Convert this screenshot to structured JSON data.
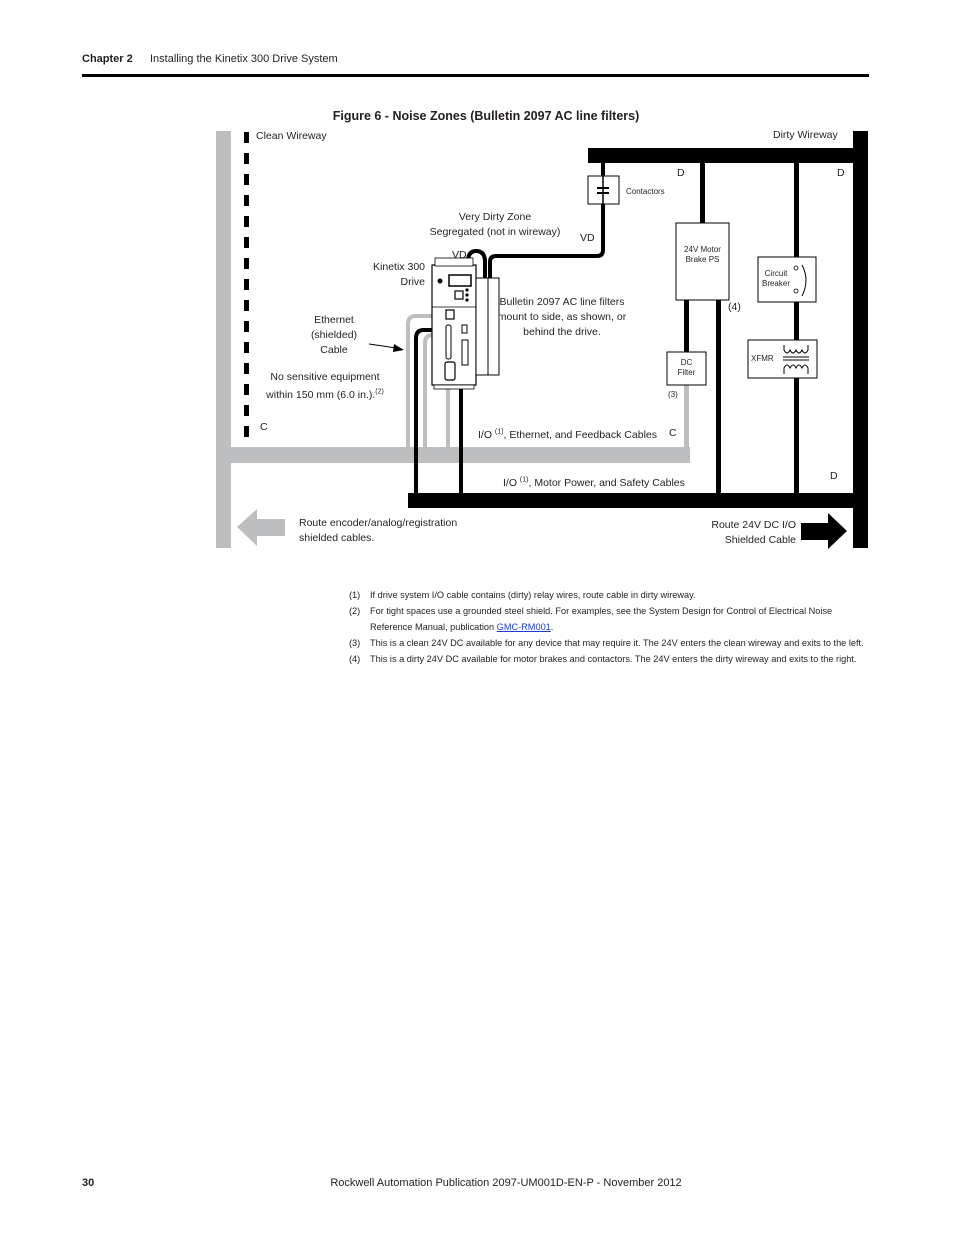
{
  "header": {
    "chapter": "Chapter 2",
    "section": "Installing the Kinetix 300 Drive System"
  },
  "figure": {
    "title": "Figure 6 - Noise Zones (Bulletin 2097 AC line filters)",
    "labels": {
      "clean_wireway": "Clean Wireway",
      "dirty_wireway": "Dirty Wireway",
      "contactors": "Contactors",
      "very_dirty_zone_line1": "Very Dirty Zone",
      "very_dirty_zone_line2": "Segregated (not in wireway)",
      "vd_top": "VD",
      "vd_drive": "VD",
      "kinetix_line1": "Kinetix 300",
      "kinetix_line2": "Drive",
      "filters_line1": "Bulletin 2097 AC line filters",
      "filters_line2": "mount to side, as shown, or",
      "filters_line3": "behind the drive.",
      "ethernet_line1": "Ethernet",
      "ethernet_line2": "(shielded)",
      "ethernet_line3": "Cable",
      "no_sensitive_line1": "No sensitive equipment",
      "no_sensitive_line2": "within 150 mm (6.0 in.).",
      "no_sensitive_ref": "(2)",
      "d_1": "D",
      "d_2": "D",
      "d_3": "D",
      "c_left": "C",
      "c_right": "C",
      "brake_ps_line1": "24V Motor",
      "brake_ps_line2": "Brake PS",
      "circuit_breaker_line1": "Circuit",
      "circuit_breaker_line2": "Breaker",
      "ref_4": "(4)",
      "dc_filter_line1": "DC",
      "dc_filter_line2": "Filter",
      "ref_3": "(3)",
      "xfmr": "XFMR",
      "io_eth_prefix": "I/O ",
      "io_eth_ref": "(1)",
      "io_eth_suffix": ", Ethernet, and Feedback Cables",
      "io_motor_prefix": "I/O ",
      "io_motor_ref": "(1)",
      "io_motor_suffix": ", Motor Power, and Safety Cables",
      "route_encoder_line1": "Route encoder/analog/registration",
      "route_encoder_line2": "shielded cables.",
      "route_24v_line1": "Route 24V DC I/O",
      "route_24v_line2": "Shielded Cable"
    }
  },
  "notes": [
    {
      "num": "(1)",
      "text": "If drive system I/O cable contains (dirty) relay wires, route cable in dirty wireway."
    },
    {
      "num": "(2)",
      "text": "For tight spaces use a grounded steel shield. For examples, see the System Design for Control of Electrical Noise Reference Manual, publication ",
      "link": "GMC-RM001",
      "after": "."
    },
    {
      "num": "(3)",
      "text": "This is a clean 24V DC available for any device that may require it. The 24V enters the clean wireway and exits to the left."
    },
    {
      "num": "(4)",
      "text": "This is a dirty 24V DC available for motor brakes and contactors. The 24V enters the dirty wireway and exits to the right."
    }
  ],
  "footer": {
    "page_number": "30",
    "publication": "Rockwell Automation Publication 2097-UM001D-EN-P - November 2012"
  },
  "colors": {
    "clean_gray": "#bcbec0",
    "dirty_black": "#000000",
    "link_blue": "#1a3fcf"
  }
}
